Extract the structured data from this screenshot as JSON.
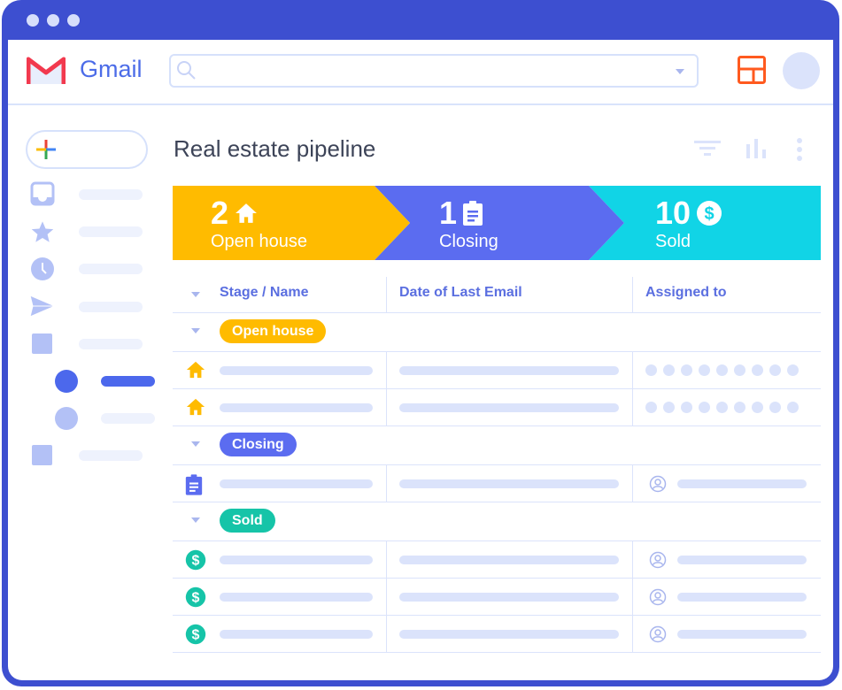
{
  "window": {
    "controls": [
      "dot",
      "dot",
      "dot"
    ]
  },
  "header": {
    "brand": "Gmail",
    "search": {
      "placeholder": "",
      "value": ""
    },
    "icons": [
      "gmail-logo-icon",
      "search-icon",
      "dropdown-caret-icon",
      "layout-icon",
      "avatar"
    ]
  },
  "sidebar": {
    "compose_icon": "plus-icon",
    "items": [
      {
        "icon": "inbox-icon"
      },
      {
        "icon": "star-icon"
      },
      {
        "icon": "clock-icon"
      },
      {
        "icon": "send-icon"
      },
      {
        "icon": "square-icon"
      },
      {
        "icon": "circle-icon",
        "active": true
      },
      {
        "icon": "circle-icon"
      },
      {
        "icon": "square-icon"
      }
    ]
  },
  "main": {
    "title": "Real estate pipeline",
    "toolbar_icons": [
      "filter-icon",
      "bar-chart-icon",
      "more-vert-icon"
    ],
    "funnel": [
      {
        "count": "2",
        "label": "Open house",
        "icon": "house-icon",
        "color": "#ffbb00"
      },
      {
        "count": "1",
        "label": "Closing",
        "icon": "clipboard-icon",
        "color": "#5b6cf0"
      },
      {
        "count": "10",
        "label": "Sold",
        "icon": "dollar-icon",
        "color": "#11d4e6"
      }
    ],
    "table": {
      "columns": [
        "Stage / Name",
        "Date of Last Email",
        "Assigned to"
      ],
      "groups": [
        {
          "label": "Open house",
          "color": "#ffbb00",
          "rows": 2,
          "row_icon": "house-icon",
          "assigned": "dots"
        },
        {
          "label": "Closing",
          "color": "#5b6cf0",
          "rows": 1,
          "row_icon": "clipboard-icon",
          "assigned": "person"
        },
        {
          "label": "Sold",
          "color": "#16c4a8",
          "rows": 3,
          "row_icon": "dollar-icon",
          "assigned": "person"
        }
      ]
    }
  }
}
